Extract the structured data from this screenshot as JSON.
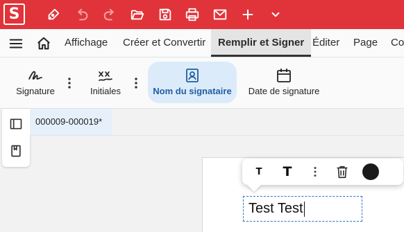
{
  "titlebar": {
    "logo_letter": "S",
    "bg_color": "#e1343a",
    "icons": [
      "pen-icon",
      "undo-icon",
      "redo-icon",
      "folder-open-icon",
      "save-icon",
      "print-icon",
      "mail-icon",
      "plus-icon",
      "chevron-down-icon"
    ]
  },
  "menubar": {
    "tabs": [
      "Affichage",
      "Créer et Convertir",
      "Remplir et Signer",
      "Éditer",
      "Page",
      "Co"
    ],
    "active_tab": "Remplir et Signer"
  },
  "ribbon": {
    "buttons": [
      {
        "label": "Signature",
        "icon": "signature-icon"
      },
      {
        "label": "Initiales",
        "icon": "initials-icon"
      },
      {
        "label": "Nom du signataire",
        "icon": "signer-name-icon",
        "active": true
      },
      {
        "label": "Date de signature",
        "icon": "calendar-icon"
      }
    ],
    "active_color": "#dcebfa"
  },
  "document": {
    "tab_name": "000009-000019*"
  },
  "floating_toolbar": {
    "small_text_glyph": "T",
    "large_text_glyph": "T",
    "text_color": "#1a1a1a"
  },
  "text_field": {
    "value": "Test Test"
  }
}
